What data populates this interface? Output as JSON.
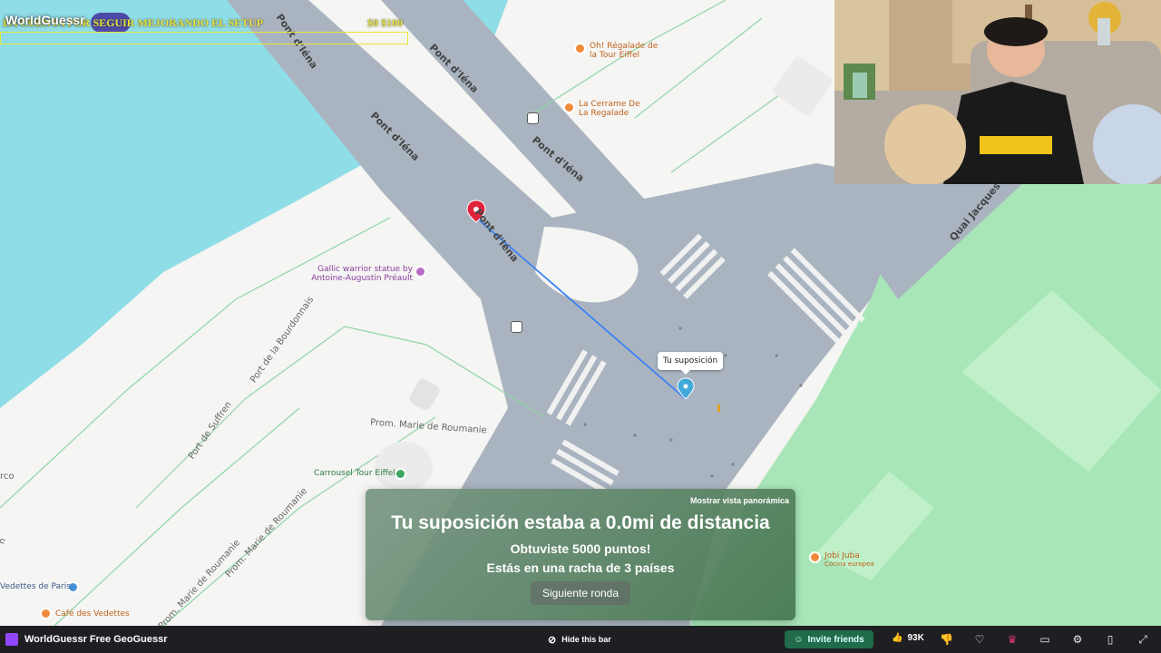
{
  "overlay": {
    "brand": "WorldGuessr",
    "banner_text": "LA CUENTA POR SEGUIR MEJORANDO EL SETUP",
    "goal_text": "$0 $100"
  },
  "map": {
    "roads": {
      "pont_iena_1": "Pont d'Iéna",
      "pont_iena_2": "Pont d'Iéna",
      "pont_iena_3": "Pont d'Iéna",
      "pont_iena_4": "Pont d'Iéna",
      "pont_iena_5": "Pont d'Iéna",
      "quai_jacques": "Quai Jacques",
      "port_bourdonnais": "Port de la Bourdonnais",
      "port_suffren": "Port de Suffren",
      "prom_roumanie_1": "Prom. Marie de Roumanie",
      "prom_roumanie_2": "Prom. Marie de Roumanie",
      "prom_roumanie_3": "Prom. Marie de Roumanie",
      "arco": "rco",
      "edge_left": "n"
    },
    "pois": {
      "regalade_tour": "Oh! Régalade de la Tour Eiffel",
      "cerrame": "La Cerrame De La Regalade",
      "gallic": "Gallic warrior statue by Antoine-Augustin Préault",
      "carrousel": "Carrousel Tour Eiffel",
      "vedettes_paris": "Vedettes de Paris",
      "cafe_vedettes": "Café des Vedettes",
      "jobi_juba": "Jobi Juba",
      "jobi_juba_sub": "Cocina europea"
    },
    "guess_tooltip": "Tu suposición"
  },
  "result": {
    "panorama_link": "Mostrar vista panorámica",
    "title": "Tu suposición estaba a 0.0mi de distancia",
    "points": "Obtuviste 5000 puntos!",
    "streak": "Estás en una racha de 3 países",
    "next_button": "Siguiente ronda"
  },
  "twitch_bar": {
    "title": "WorldGuessr Free GeoGuessr",
    "hide_label": "Hide this bar",
    "invite_label": "Invite friends",
    "likes": "93K"
  },
  "colors": {
    "water": "#8fdde6",
    "road": "#aab4c0",
    "park": "#a8e6b8",
    "accent_green": "#1f6b4a"
  }
}
